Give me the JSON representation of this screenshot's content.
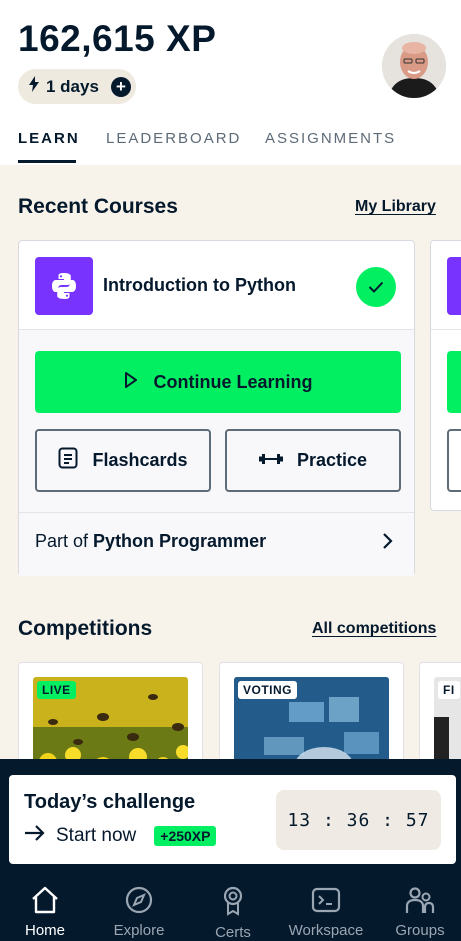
{
  "header": {
    "xp": "162,615 XP",
    "streak_label": "1 days",
    "streak_add_symbol": "+",
    "avatar_icon": "user-avatar"
  },
  "tabs": [
    {
      "label": "LEARN",
      "active": true
    },
    {
      "label": "LEADERBOARD",
      "active": false
    },
    {
      "label": "ASSIGNMENTS",
      "active": false
    }
  ],
  "recent": {
    "title": "Recent Courses",
    "link": "My Library",
    "course": {
      "title": "Introduction to Python",
      "icon": "python-icon",
      "completed": true,
      "continue_label": "Continue Learning",
      "flashcards_label": "Flashcards",
      "practice_label": "Practice",
      "part_of_prefix": "Part of",
      "track": "Python Programmer"
    }
  },
  "competitions": {
    "title": "Competitions",
    "link": "All competitions",
    "cards": [
      {
        "badge": "LIVE"
      },
      {
        "badge": "VOTING"
      },
      {
        "badge": "FI"
      }
    ]
  },
  "challenge": {
    "title": "Today’s challenge",
    "start": "Start now",
    "xp": "+250XP",
    "timer": "13 : 36 : 57"
  },
  "nav": [
    {
      "label": "Home",
      "icon": "home-icon",
      "active": true
    },
    {
      "label": "Explore",
      "icon": "compass-icon",
      "active": false
    },
    {
      "label": "Certs",
      "icon": "certificate-icon",
      "active": false
    },
    {
      "label": "Workspace",
      "icon": "terminal-icon",
      "active": false
    },
    {
      "label": "Groups",
      "icon": "groups-icon",
      "active": false
    }
  ],
  "colors": {
    "brand_green": "#03ef62",
    "navy": "#05192d",
    "course_purple": "#7933ff",
    "background": "#f7f3eb"
  }
}
